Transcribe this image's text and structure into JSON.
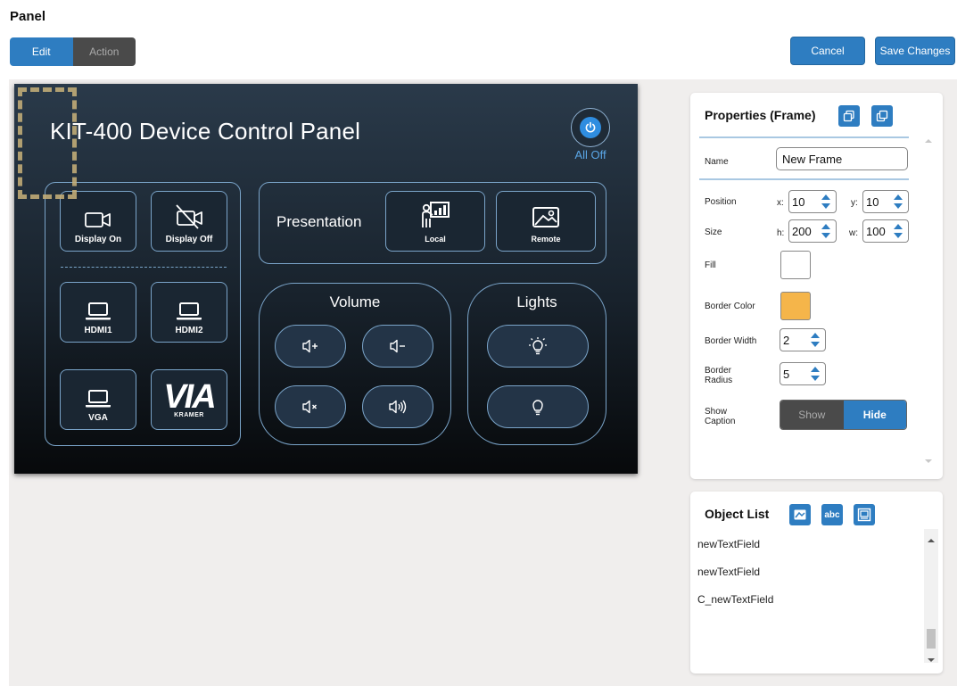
{
  "page": {
    "title": "Panel"
  },
  "mode": {
    "edit_label": "Edit",
    "action_label": "Action",
    "selected": "Edit"
  },
  "toolbar": {
    "cancel_label": "Cancel",
    "save_label": "Save Changes"
  },
  "canvas": {
    "title": "KIT-400 Device Control Panel",
    "all_off_label": "All Off",
    "display_group": {
      "buttons": [
        {
          "label": "Display On",
          "icon": "camera-icon"
        },
        {
          "label": "Display Off",
          "icon": "camera-off-icon"
        },
        {
          "label": "HDMI1",
          "icon": "laptop-icon"
        },
        {
          "label": "HDMI2",
          "icon": "laptop-icon"
        },
        {
          "label": "VGA",
          "icon": "laptop-icon"
        }
      ],
      "logo": {
        "main": "VIA",
        "sub": "KRAMER"
      }
    },
    "presentation": {
      "label": "Presentation",
      "buttons": [
        {
          "label": "Local",
          "icon": "presenter-icon"
        },
        {
          "label": "Remote",
          "icon": "image-icon"
        }
      ]
    },
    "volume": {
      "title": "Volume",
      "buttons": [
        "volume-up-icon",
        "volume-down-icon",
        "mute-icon",
        "volume-icon"
      ]
    },
    "lights": {
      "title": "Lights",
      "buttons": [
        "light-on-icon",
        "light-off-icon"
      ]
    }
  },
  "properties": {
    "title": "Properties (Frame)",
    "name_label": "Name",
    "name_value": "New Frame",
    "position_label": "Position",
    "x_label": "x:",
    "x_value": "10",
    "y_label": "y:",
    "y_value": "10",
    "size_label": "Size",
    "h_label": "h:",
    "h_value": "200",
    "w_label": "w:",
    "w_value": "100",
    "fill_label": "Fill",
    "fill_color": "#ffffff",
    "border_color_label": "Border Color",
    "border_color": "#f5b54a",
    "border_width_label": "Border Width",
    "border_width_value": "2",
    "border_radius_label": "Border Radius",
    "border_radius_value": "5",
    "show_caption_label": "Show Caption",
    "show_label": "Show",
    "hide_label": "Hide",
    "caption_selected": "Hide"
  },
  "object_list": {
    "title": "Object List",
    "items": [
      "newTextField",
      "newTextField",
      "C_newTextField"
    ]
  },
  "colors": {
    "accent": "#2e7dc1",
    "canvas_border": "#7aa4c9",
    "frame_selection": "#c9b27a"
  }
}
